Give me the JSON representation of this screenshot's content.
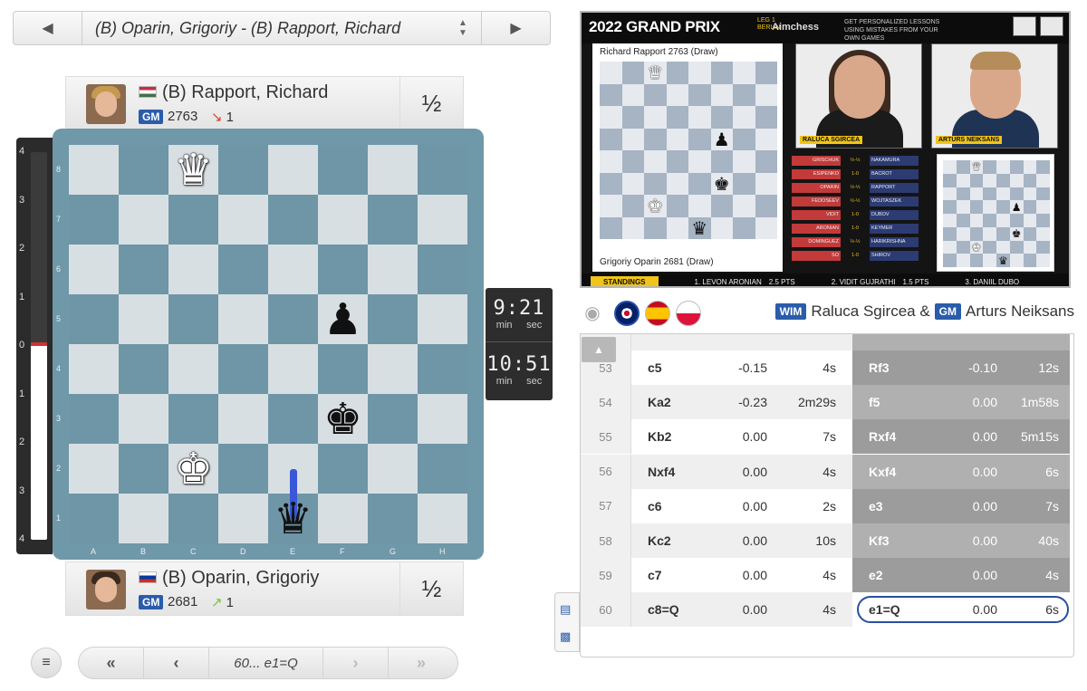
{
  "game_selector": {
    "title": "(B) Oparin, Grigoriy - (B) Rapport, Richard",
    "prev_icon": "◀",
    "next_icon": "▶",
    "up_icon": "▲",
    "down_icon": "▼"
  },
  "players": {
    "top": {
      "name": "(B) Rapport, Richard",
      "title": "GM",
      "rating": "2763",
      "change": "1",
      "change_dir": "down",
      "score": "½"
    },
    "bottom": {
      "name": "(B) Oparin, Grigoriy",
      "title": "GM",
      "rating": "2681",
      "change": "1",
      "change_dir": "up",
      "score": "½"
    }
  },
  "eval_bar": {
    "ticks": [
      "4",
      "3",
      "2",
      "1",
      "0",
      "1",
      "2",
      "3",
      "4"
    ],
    "white_fraction": 0.5
  },
  "board": {
    "ranks": [
      "8",
      "7",
      "6",
      "5",
      "4",
      "3",
      "2",
      "1"
    ],
    "files": [
      "A",
      "B",
      "C",
      "D",
      "E",
      "F",
      "G",
      "H"
    ],
    "pieces": [
      {
        "sq": "c8",
        "glyph": "♛",
        "color": "w"
      },
      {
        "sq": "f5",
        "glyph": "♟",
        "color": "b"
      },
      {
        "sq": "f3",
        "glyph": "♚",
        "color": "b"
      },
      {
        "sq": "c2",
        "glyph": "♚",
        "color": "w"
      },
      {
        "sq": "e1",
        "glyph": "♛",
        "color": "b"
      }
    ],
    "last_move": {
      "from": "e2",
      "to": "e1"
    },
    "arrow_color": "#3a57d8"
  },
  "clocks": {
    "top": {
      "time": "9:21",
      "unit_min": "min",
      "unit_sec": "sec"
    },
    "bottom": {
      "time": "10:51",
      "unit_min": "min",
      "unit_sec": "sec"
    }
  },
  "navigation": {
    "menu_icon": "≡",
    "first_icon": "«",
    "prev_icon": "‹",
    "current_move": "60... e1=Q",
    "next_icon": "›",
    "last_icon": "»"
  },
  "video": {
    "title": "2022 GRAND PRIX",
    "leg": "LEG 1",
    "city": "BERLIN",
    "sponsor": "Aimchess",
    "promo": "GET PERSONALIZED LESSONS USING MISTAKES FROM YOUR OWN GAMES",
    "board_top": "Richard Rapport 2763 (Draw)",
    "board_bottom": "Grigoriy Oparin 2681 (Draw)",
    "cam1_caption": "RALUCA SGIRCEA",
    "cam2_caption": "ARTURS NEIKSANS",
    "standings_label": "STANDINGS",
    "standings_rows": [
      {
        "a": "GRISCHUK",
        "r": "½-½",
        "b": "NAKAMURA"
      },
      {
        "a": "ESIPENKO",
        "r": "1-0",
        "b": "BACROT"
      },
      {
        "a": "OPARIN",
        "r": "½-½",
        "b": "RAPPORT"
      },
      {
        "a": "FEDOSEEV",
        "r": "½-½",
        "b": "WOJTASZEK"
      },
      {
        "a": "VIDIT",
        "r": "1-0",
        "b": "DUBOV"
      },
      {
        "a": "ARONIAN",
        "r": "1-0",
        "b": "KEYMER"
      },
      {
        "a": "DOMINGUEZ",
        "r": "½-½",
        "b": "HARIKRISHNA"
      },
      {
        "a": "SO",
        "r": "1-0",
        "b": "SHIROV"
      }
    ],
    "footer_1": "1. LEVON ARONIAN",
    "footer_1_pts": "2.5 PTS",
    "footer_2": "2. VIDIT GUJRATHI",
    "footer_2_pts": "1.5 PTS",
    "footer_3": "3. DANIIL DUBO"
  },
  "commentators": {
    "camera_icon": "camera-icon",
    "languages": [
      "en",
      "es",
      "pl"
    ],
    "c1_title": "WIM",
    "c1_name": "Raluca Sgircea &",
    "c2_title": "GM",
    "c2_name": "Arturs Neiksans"
  },
  "moves": {
    "rows": [
      {
        "num": "53",
        "w": "c5",
        "we": "-0.15",
        "wt": "4s",
        "b": "Rf3",
        "be": "-0.10",
        "bt": "12s"
      },
      {
        "num": "54",
        "w": "Ka2",
        "we": "-0.23",
        "wt": "2m29s",
        "b": "f5",
        "be": "0.00",
        "bt": "1m58s"
      },
      {
        "num": "55",
        "w": "Kb2",
        "we": "0.00",
        "wt": "7s",
        "b": "Rxf4",
        "be": "0.00",
        "bt": "5m15s"
      },
      {
        "num": "56",
        "w": "Nxf4",
        "we": "0.00",
        "wt": "4s",
        "b": "Kxf4",
        "be": "0.00",
        "bt": "6s"
      },
      {
        "num": "57",
        "w": "c6",
        "we": "0.00",
        "wt": "2s",
        "b": "e3",
        "be": "0.00",
        "bt": "7s"
      },
      {
        "num": "58",
        "w": "Kc2",
        "we": "0.00",
        "wt": "10s",
        "b": "Kf3",
        "be": "0.00",
        "bt": "40s"
      },
      {
        "num": "59",
        "w": "c7",
        "we": "0.00",
        "wt": "4s",
        "b": "e2",
        "be": "0.00",
        "bt": "4s"
      },
      {
        "num": "60",
        "w": "c8=Q",
        "we": "0.00",
        "wt": "4s",
        "b": "e1=Q",
        "be": "0.00",
        "bt": "6s"
      }
    ],
    "active_index": 7,
    "scroll_up_icon": "▲"
  }
}
